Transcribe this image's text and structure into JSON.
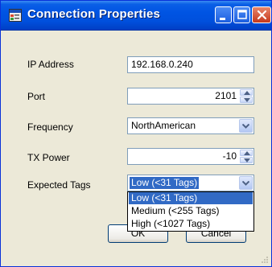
{
  "window": {
    "title": "Connection Properties",
    "icon": "app-window-icon"
  },
  "title_buttons": [
    {
      "name": "minimize",
      "icon": "minimize-icon"
    },
    {
      "name": "maximize",
      "icon": "maximize-icon"
    },
    {
      "name": "close",
      "icon": "close-icon"
    }
  ],
  "form": {
    "ip_address": {
      "label": "IP Address",
      "value": "192.168.0.240"
    },
    "port": {
      "label": "Port",
      "value": "2101"
    },
    "frequency": {
      "label": "Frequency",
      "value": "NorthAmerican"
    },
    "tx_power": {
      "label": "TX Power",
      "value": "-10"
    },
    "expected_tags": {
      "label": "Expected Tags",
      "value": "Low (<31 Tags)",
      "options": [
        "Low (<31 Tags)",
        "Medium (<255 Tags)",
        "High (<1027 Tags)"
      ],
      "selected_index": 0
    }
  },
  "buttons": {
    "ok": "OK",
    "cancel": "Cancel"
  },
  "colors": {
    "titlebar": "#0054e3",
    "selection": "#316ac5",
    "window_bg": "#ece9d8",
    "field_border": "#7f9db9"
  }
}
